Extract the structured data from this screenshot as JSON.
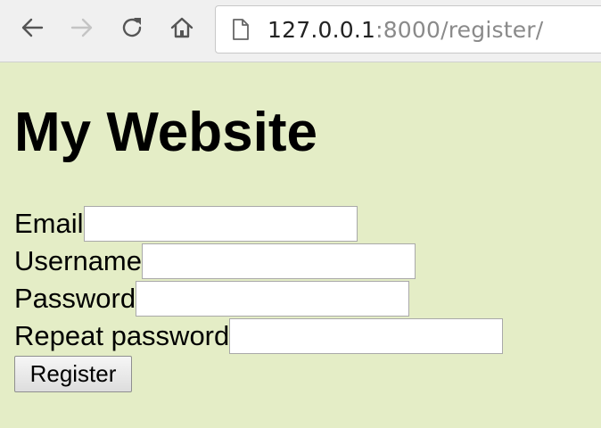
{
  "browser": {
    "url_host": "127.0.0.1",
    "url_rest": ":8000/register/",
    "icons": {
      "back": "back-arrow-icon",
      "forward": "forward-arrow-icon",
      "reload": "reload-icon",
      "home": "home-icon",
      "page": "page-icon"
    }
  },
  "page": {
    "title": "My Website",
    "form": {
      "email_label": "Email",
      "email_value": "",
      "username_label": "Username",
      "username_value": "",
      "password_label": "Password",
      "password_value": "",
      "repeat_password_label": "Repeat password",
      "repeat_password_value": "",
      "submit_label": "Register"
    }
  },
  "colors": {
    "page_background": "#e4edc6",
    "toolbar_background": "#f0f0f0",
    "url_host": "#222222",
    "url_rest": "#8a8a8a"
  }
}
